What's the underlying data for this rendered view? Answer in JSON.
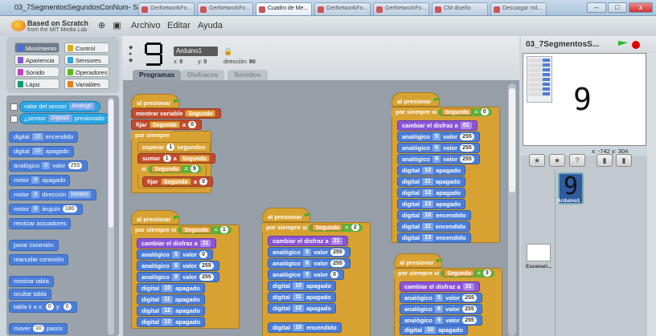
{
  "window": {
    "title": "03_7SegmentosSegundosConNum- S4A 1.5",
    "tabs": [
      "GerNetworkFo...",
      "GerNetworkFo...",
      "Cuadro de Me...",
      "GerNetworkFo...",
      "GerNetworkFo...",
      "CM diseño",
      "Descargar mil..."
    ],
    "controls": [
      "–",
      "□",
      "x"
    ]
  },
  "app": {
    "logo_title": "Based on Scratch",
    "logo_subtitle": "from the MIT Media Lab",
    "menus": [
      "Archivo",
      "Editar",
      "Ayuda"
    ]
  },
  "categories": [
    {
      "label": "Movimiento",
      "color": "#4a6cd4",
      "selected": true
    },
    {
      "label": "Control",
      "color": "#e1a91a"
    },
    {
      "label": "Apariencia",
      "color": "#8a55d7"
    },
    {
      "label": "Sensores",
      "color": "#2ca5e2"
    },
    {
      "label": "Sonido",
      "color": "#bb42c3"
    },
    {
      "label": "Operadores",
      "color": "#5cb712"
    },
    {
      "label": "Lápiz",
      "color": "#0e9a6c"
    },
    {
      "label": "Variables",
      "color": "#ee7d16"
    }
  ],
  "palette": {
    "sensor_value": {
      "label": "valor del sensor",
      "option": "Analog0"
    },
    "sensor_pressed": {
      "label": "¿sensor",
      "option": "Digital2",
      "suffix": "presionado"
    },
    "digital_on": {
      "label": "digital",
      "pin": "10",
      "action": "encendido"
    },
    "digital_off": {
      "label": "digital",
      "pin": "10",
      "action": "apagado"
    },
    "analog": {
      "label": "analógico",
      "pin": "5",
      "mid": "valor",
      "value": "255"
    },
    "motor_off": {
      "label": "motor",
      "pin": "4",
      "action": "apagado"
    },
    "motor_dir": {
      "label": "motor",
      "pin": "4",
      "mid": "dirección",
      "option": "horario"
    },
    "motor_angle": {
      "label": "motor",
      "pin": "8",
      "mid": "ángulo",
      "value": "180"
    },
    "reset": "reiniciar actuadores",
    "stop_conn": "parar conexión",
    "resume_conn": "reanudar conexión",
    "show_table": "mostrar tabla",
    "hide_table": "ocultar tabla",
    "table_goto": {
      "label": "tabla ir a x:",
      "x": "0",
      "ylabel": "y:",
      "y": "0"
    },
    "move": {
      "label": "mover",
      "value": "10",
      "suffix": "pasos"
    }
  },
  "sprite": {
    "name": "Arduino1",
    "x_label": "x:",
    "x": "0",
    "y_label": "y:",
    "y": "0",
    "dir_label": "dirección:",
    "dir": "90",
    "digit": "9"
  },
  "content_tabs": [
    "Programas",
    "Disfraces",
    "Sonidos"
  ],
  "scripts": {
    "hat": "al presionar",
    "forever_if": "por siempre si",
    "var": "Segundo",
    "s1": {
      "set_show": "mostrar variable",
      "set_label": "fijar",
      "to": "a",
      "val0": "0",
      "forever": "por siempre",
      "wait": "esperar",
      "wait_val": "1",
      "wait_unit": "segundos",
      "change": "sumar",
      "change_val": "1",
      "if": "si",
      "cmp_val": "9"
    },
    "s2": {
      "cond": "1",
      "costume": "cambiar el disfraz a",
      "costume_val": "11",
      "rows": [
        [
          "analógico",
          "5",
          "valor",
          "0"
        ],
        [
          "analógico",
          "6",
          "valor",
          "255"
        ],
        [
          "analógico",
          "9",
          "valor",
          "255"
        ],
        [
          "digital",
          "10",
          "apagado"
        ],
        [
          "digital",
          "11",
          "apagado"
        ],
        [
          "digital",
          "12",
          "apagado"
        ],
        [
          "digital",
          "13",
          "apagado"
        ]
      ]
    },
    "s3": {
      "cond": "2",
      "costume": "cambiar el disfraz a",
      "costume_val": "21",
      "rows": [
        [
          "analógico",
          "5",
          "valor",
          "255"
        ],
        [
          "analógico",
          "6",
          "valor",
          "255"
        ],
        [
          "analógico",
          "9",
          "valor",
          "0"
        ],
        [
          "digital",
          "10",
          "apagado"
        ],
        [
          "digital",
          "11",
          "apagado"
        ],
        [
          "digital",
          "12",
          "apagado"
        ],
        [
          "digital",
          "10",
          "encendido"
        ]
      ]
    },
    "s4": {
      "cond": "0",
      "costume": "cambiar el disfraz a",
      "costume_val": "01",
      "rows": [
        [
          "analógico",
          "5",
          "valor",
          "255"
        ],
        [
          "analógico",
          "6",
          "valor",
          "255"
        ],
        [
          "analógico",
          "9",
          "valor",
          "255"
        ],
        [
          "digital",
          "12",
          "apagado"
        ],
        [
          "digital",
          "11",
          "apagado"
        ],
        [
          "digital",
          "12",
          "apagado"
        ],
        [
          "digital",
          "13",
          "apagado"
        ],
        [
          "digital",
          "10",
          "encendido"
        ],
        [
          "digital",
          "11",
          "encendido"
        ],
        [
          "digital",
          "13",
          "encendido"
        ]
      ]
    },
    "s5": {
      "cond": "3",
      "costume": "cambiar el disfraz a",
      "costume_val": "31",
      "rows": [
        [
          "analógico",
          "5",
          "valor",
          "255"
        ],
        [
          "analógico",
          "6",
          "valor",
          "255"
        ],
        [
          "analógico",
          "9",
          "valor",
          "255"
        ],
        [
          "digital",
          "10",
          "apagado"
        ]
      ]
    }
  },
  "stage": {
    "title": "03_7SegmentosS...",
    "coords": "x: -742  y: 304",
    "sprite_label": "Arduino1",
    "stage_label": "Escenari..."
  }
}
